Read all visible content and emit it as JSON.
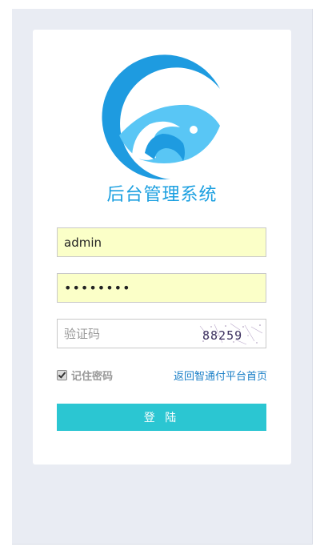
{
  "app": {
    "title": "后台管理系统"
  },
  "form": {
    "username_value": "admin",
    "password_value": "••••••••",
    "captcha_placeholder": "验证码",
    "captcha_image_text": "88259",
    "remember_label": "记住密码",
    "remember_checked": true,
    "back_link_label": "返回智通付平台首页",
    "login_button_label": "登 陆"
  },
  "colors": {
    "brand_blue": "#1a9fe0",
    "button_teal": "#2bc6d2",
    "link_blue": "#1a7fc7",
    "autofill_yellow": "#fbffc8"
  }
}
